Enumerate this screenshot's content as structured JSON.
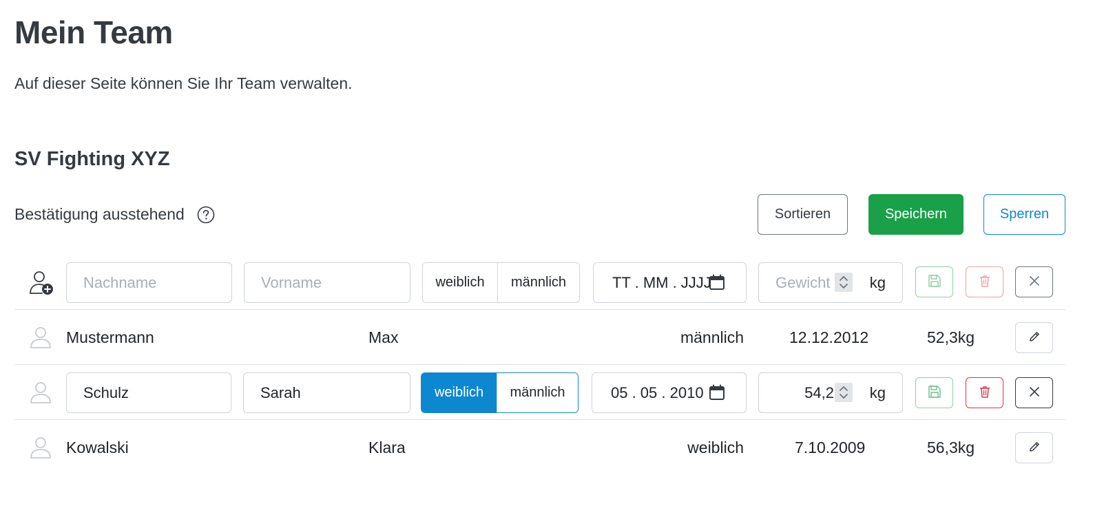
{
  "page": {
    "title": "Mein Team",
    "description": "Auf dieser Seite können Sie Ihr Team verwalten."
  },
  "team": {
    "name": "SV Fighting XYZ",
    "status": "Bestätigung ausstehend"
  },
  "actions": {
    "sort_label": "Sortieren",
    "save_label": "Speichern",
    "lock_label": "Sperren"
  },
  "new_row": {
    "lastname_placeholder": "Nachname",
    "firstname_placeholder": "Vorname",
    "gender_options": [
      "weiblich",
      "männlich"
    ],
    "date_placeholder": "TT . MM . JJJJ",
    "weight_placeholder": "Gewicht",
    "weight_unit": "kg"
  },
  "members": [
    {
      "lastname": "Mustermann",
      "firstname": "Max",
      "gender": "männlich",
      "birthdate": "12.12.2012",
      "weight": "52,3kg",
      "editing": false
    },
    {
      "lastname": "Schulz",
      "firstname": "Sarah",
      "gender": "weiblich",
      "birthdate": "05 . 05 . 2010",
      "weight": "54,2",
      "weight_unit": "kg",
      "editing": true,
      "gender_options": [
        "weiblich",
        "männlich"
      ],
      "gender_selected": "weiblich"
    },
    {
      "lastname": "Kowalski",
      "firstname": "Klara",
      "gender": "weiblich",
      "birthdate": "7.10.2009",
      "weight": "56,3kg",
      "editing": false
    }
  ],
  "icons": {
    "help": "question-circle-icon",
    "add_user": "person-plus-icon",
    "avatar": "person-icon",
    "calendar": "calendar-icon",
    "save": "floppy-disk-icon",
    "delete": "trash-icon",
    "cancel": "x-icon",
    "edit": "pencil-icon"
  },
  "colors": {
    "primary": "#0d87d0",
    "success": "#1aa049",
    "danger": "#dc3545"
  }
}
